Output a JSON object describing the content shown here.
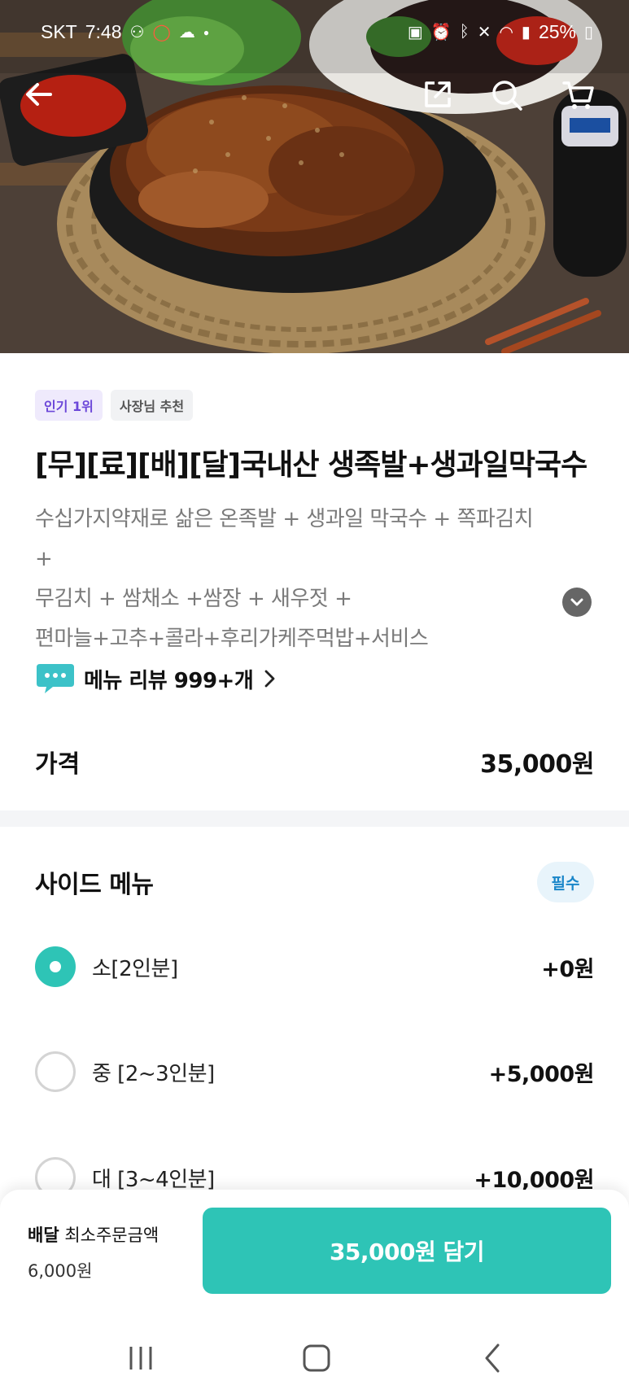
{
  "status_bar": {
    "carrier": "SKT",
    "time": "7:48",
    "battery": "25%"
  },
  "hero": {
    "image_desc": "food-photo",
    "icons": [
      "back-arrow-icon",
      "share-icon",
      "search-icon",
      "cart-icon"
    ]
  },
  "badges": {
    "popular": "인기 1위",
    "owner_pick": "사장님 추천"
  },
  "menu": {
    "title": "[무][료][배][달]국내산 생족발+생과일막국수",
    "description_lines": [
      "수십가지약재로 삶은 온족발 + 생과일 막국수 + 쪽파김치 +",
      "무김치 + 쌈채소 +쌈장 + 새우젓 +",
      "편마늘+고추+콜라+후리가케주먹밥+서비스"
    ],
    "review_label": "메뉴 리뷰 999+개",
    "price_label": "가격",
    "price_value": "35,000원"
  },
  "side_menu": {
    "title": "사이드 메뉴",
    "required": "필수",
    "options": [
      {
        "label": "소[2인분]",
        "price": "+0원",
        "selected": true
      },
      {
        "label": "중 [2~3인분]",
        "price": "+5,000원",
        "selected": false
      },
      {
        "label": "대 [3~4인분]",
        "price": "+10,000원",
        "selected": false
      }
    ]
  },
  "bottom": {
    "delivery_label": "배달",
    "min_order_label": "최소주문금액",
    "min_order_amount": "6,000원",
    "cta_label": "35,000원 담기"
  },
  "colors": {
    "accent": "#2ec4b6",
    "badge_purple": "#6c47d9",
    "required_blue": "#1a86c9"
  }
}
